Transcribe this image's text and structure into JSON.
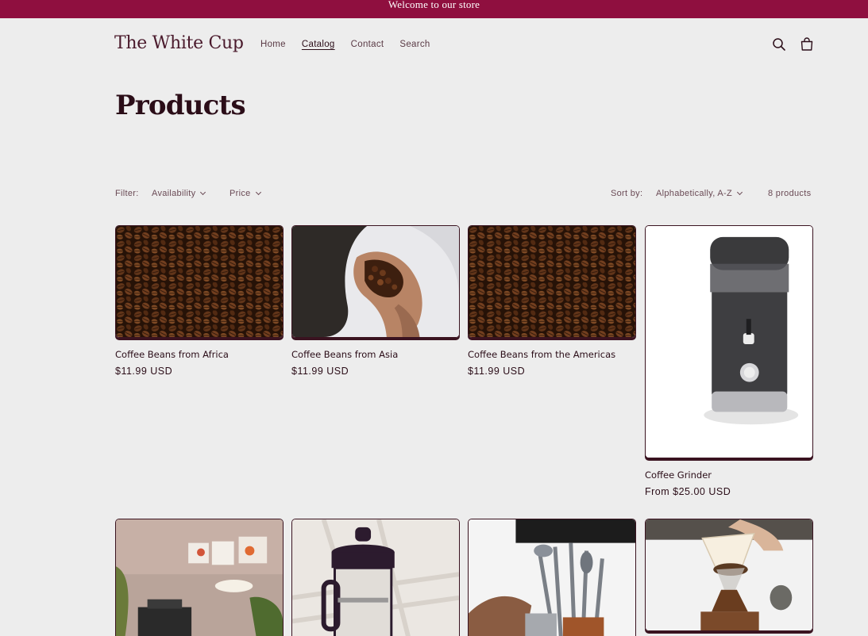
{
  "announcement": "Welcome to our store",
  "header": {
    "logo": "The White Cup",
    "nav": [
      "Home",
      "Catalog",
      "Contact",
      "Search"
    ],
    "active_nav": "Catalog",
    "icons": [
      "search-icon",
      "cart-icon"
    ]
  },
  "collection": {
    "title": "Products"
  },
  "facets": {
    "filter_label": "Filter:",
    "availability": "Availability",
    "price": "Price",
    "sort_label": "Sort by:",
    "sort_value": "Alphabetically, A-Z",
    "count": "8 products"
  },
  "products": [
    {
      "title": "Coffee Beans from Africa",
      "price": "$11.99 USD",
      "image": "coffee-beans"
    },
    {
      "title": "Coffee Beans from Asia",
      "price": "$11.99 USD",
      "image": "hand-holding-beans"
    },
    {
      "title": "Coffee Beans from the Americas",
      "price": "$11.99 USD",
      "image": "coffee-beans"
    },
    {
      "title": "Coffee Grinder",
      "price": "From $25.00 USD",
      "image": "coffee-grinder"
    },
    {
      "title": "",
      "price": "",
      "image": "espresso-machine-room"
    },
    {
      "title": "",
      "price": "",
      "image": "french-press"
    },
    {
      "title": "",
      "price": "",
      "image": "moka-pot-utensils"
    },
    {
      "title": "",
      "price": "",
      "image": "pour-over-chemex"
    }
  ],
  "colors": {
    "accent": "#8f0f3f",
    "text": "#2b0d18",
    "background": "#ededed"
  }
}
